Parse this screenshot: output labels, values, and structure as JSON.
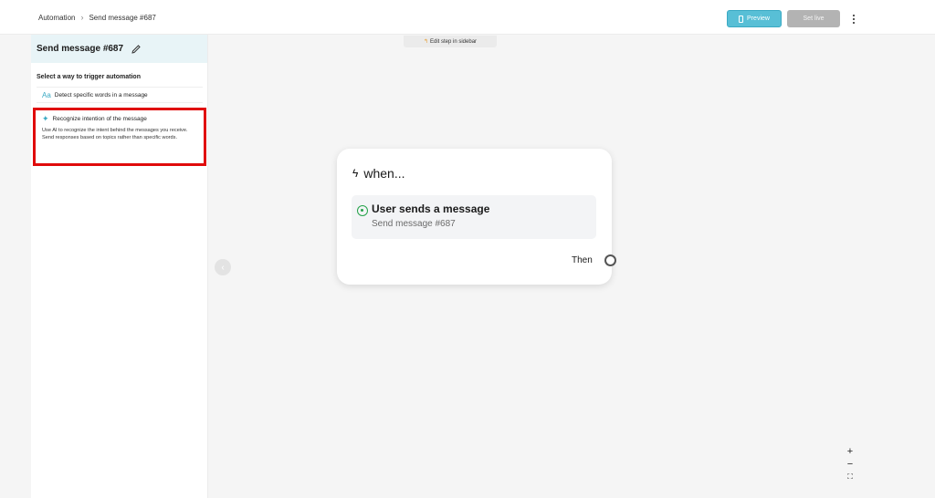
{
  "breadcrumb": {
    "root": "Automation",
    "current": "Send message #687"
  },
  "toolbar": {
    "preview_label": "Preview",
    "set_live_label": "Set live"
  },
  "sidebar": {
    "title": "Send message #687",
    "section_label": "Select a way to trigger automation",
    "options": [
      {
        "icon": "Aa",
        "label": "Detect specific words in a message"
      },
      {
        "icon": "sparkle",
        "label": "Recognize intention of the message",
        "description": "Use AI to recognize the intent behind the messages you receive. Send responses based on topics rather than specific words."
      }
    ]
  },
  "canvas": {
    "edit_hint": "Edit step in sidebar",
    "node": {
      "header": "when...",
      "trigger_title": "User sends a message",
      "trigger_subtitle": "Send message #687",
      "then_label": "Then"
    },
    "zoom": {
      "in": "+",
      "out": "−",
      "fit": "⛶"
    }
  },
  "colors": {
    "accent": "#58bfd6",
    "highlight": "#e00b0b",
    "whatsapp": "#25a34a"
  }
}
